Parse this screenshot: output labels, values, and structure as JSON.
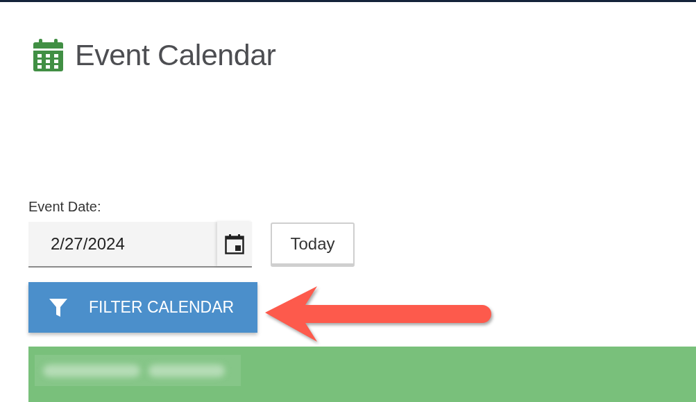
{
  "header": {
    "title": "Event Calendar"
  },
  "date_filter": {
    "label": "Event Date:",
    "value": "2/27/2024",
    "today_button": "Today"
  },
  "filter_button": {
    "label": "FILTER CALENDAR"
  },
  "annotation": {
    "kind": "arrow"
  },
  "legend_bar": {
    "label_blurred": true
  }
}
